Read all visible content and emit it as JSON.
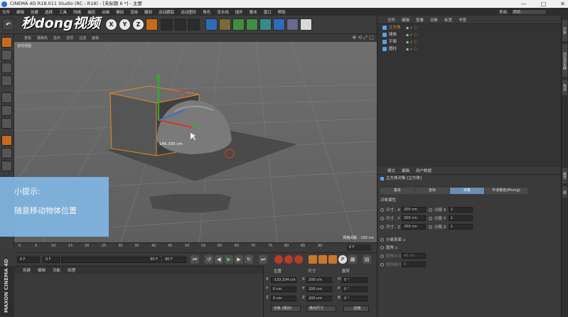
{
  "window": {
    "title": "CINEMA 4D R18.011 Studio (RC - R18) - [未标题 6 *] - 主要",
    "min": "—",
    "max": "□",
    "close": "✕"
  },
  "menubar": {
    "items": [
      "文件",
      "编辑",
      "创建",
      "选择",
      "工具",
      "网格",
      "捕捉",
      "动画",
      "模拟",
      "渲染",
      "雕刻",
      "运动跟踪",
      "运动图形",
      "角色",
      "流水线",
      "插件",
      "脚本",
      "窗口",
      "帮助"
    ],
    "layout_label": "界面:",
    "layout_value": "启动"
  },
  "watermark": "秒dong视频",
  "toolbar": {
    "undo": "↶",
    "x": "X",
    "y": "Y",
    "z": "Z"
  },
  "viewport": {
    "menu": [
      "查看",
      "摄像机",
      "显示",
      "选项",
      "过滤",
      "面板"
    ],
    "label": "透视视图",
    "grid_info": "网格间距 : 100 cm",
    "measure": "146.335 cm",
    "nav_icons": "✥ ⟲ ⤢ ▢"
  },
  "tip": {
    "title": "小提示:",
    "body": "随意移动物体位置"
  },
  "timeline": {
    "ticks": [
      "0",
      "5",
      "10",
      "15",
      "20",
      "25",
      "30",
      "35",
      "40",
      "45",
      "50",
      "55",
      "60",
      "65",
      "70",
      "75",
      "80",
      "85",
      "90"
    ],
    "end_field": "0 F"
  },
  "transport": {
    "start": "0 F",
    "preview_start": "0 F",
    "preview_end": "90 F",
    "end": "90 F"
  },
  "materials_menu": [
    "创建",
    "编辑",
    "功能",
    "纹理"
  ],
  "brand": "MAXON CINEMA 4D",
  "coords": {
    "headers": [
      "位置",
      "尺寸",
      "旋转"
    ],
    "rows": [
      {
        "axis": "X",
        "pos": "-133.104 cm",
        "size_axis": "X",
        "size": "200 cm",
        "rot_axis": "H",
        "rot": "0 °"
      },
      {
        "axis": "Y",
        "pos": "0 cm",
        "size_axis": "Y",
        "size": "200 cm",
        "rot_axis": "P",
        "rot": "0 °"
      },
      {
        "axis": "Z",
        "pos": "0 cm",
        "size_axis": "Z",
        "size": "200 cm",
        "rot_axis": "B",
        "rot": "0 °"
      }
    ],
    "mode_object": "对象 (相对)",
    "mode_size": "绝对尺寸",
    "apply": "应用"
  },
  "object_manager": {
    "menu": [
      "文件",
      "编辑",
      "查看",
      "对象",
      "标签",
      "书签"
    ],
    "objects": [
      {
        "name": "立方体"
      },
      {
        "name": "球体"
      },
      {
        "name": "平面"
      },
      {
        "name": "圆柱"
      }
    ]
  },
  "attributes": {
    "menu": [
      "模式",
      "编辑",
      "用户数据"
    ],
    "title": "立方体对象 [立方体]",
    "tabs": [
      "基本",
      "坐标",
      "对象",
      "平滑着色(Phong)"
    ],
    "active_tab": 2,
    "section": "对象属性",
    "rows": [
      {
        "label": "尺寸 . X",
        "value": "200 cm",
        "seg_label": "分段 X",
        "seg": "1"
      },
      {
        "label": "尺寸 . Y",
        "value": "200 cm",
        "seg_label": "分段 Y",
        "seg": "1"
      },
      {
        "label": "尺寸 . Z",
        "value": "200 cm",
        "seg_label": "分段 Z",
        "seg": "1"
      }
    ],
    "separate": "分离表面",
    "fillet": "圆角",
    "fillet_radius_label": "圆角半径",
    "fillet_radius": "40 cm",
    "fillet_sub_label": "圆角细分",
    "fillet_sub": "5"
  },
  "right_tabs": [
    "对象",
    "内容浏览器",
    "构造",
    "属性",
    "层"
  ],
  "colors": {
    "accent": "#6b8cb3",
    "tip_bg": "#7fb4e0",
    "selection_orange": "#e08a2a"
  }
}
